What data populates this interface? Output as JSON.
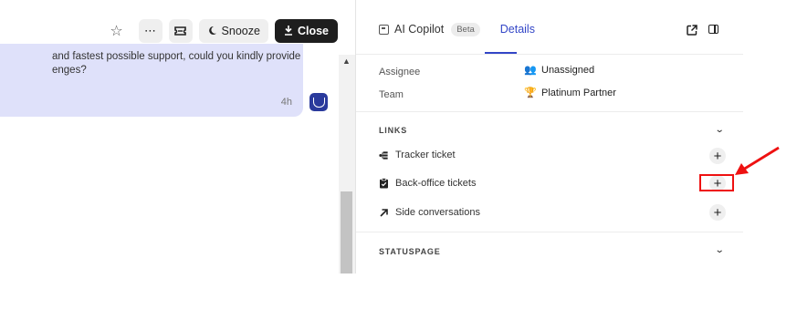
{
  "toolbar": {
    "star_icon": "star-icon",
    "more_icon": "more-icon",
    "ticket_icon": "ticket-icon",
    "snooze_label": "Snooze",
    "close_label": "Close"
  },
  "conversation": {
    "message_lines": [
      "and fastest possible support, could you kindly provide",
      "enges?"
    ],
    "message_time": "4h"
  },
  "details_panel": {
    "tabs": [
      {
        "label": "AI Copilot",
        "badge": "Beta"
      },
      {
        "label": "Details"
      }
    ],
    "active_tab": "Details",
    "fields": [
      {
        "label": "Assignee",
        "value": "Unassigned",
        "icon": "users-icon"
      },
      {
        "label": "Team",
        "value": "Platinum Partner",
        "icon": "trophy-icon"
      }
    ],
    "links_section": {
      "title": "LINKS",
      "items": [
        {
          "label": "Tracker ticket",
          "icon": "tracker-icon"
        },
        {
          "label": "Back-office tickets",
          "icon": "clipboard-icon"
        },
        {
          "label": "Side conversations",
          "icon": "arrow-up-right-icon"
        }
      ]
    },
    "statuspage_section": {
      "title": "STATUSPAGE"
    }
  },
  "annotation": {
    "color": "#ee1111"
  },
  "colors": {
    "accent": "#3346c7",
    "message_bg": "#dfe1fa",
    "close_button_bg": "#1e1e1e"
  }
}
